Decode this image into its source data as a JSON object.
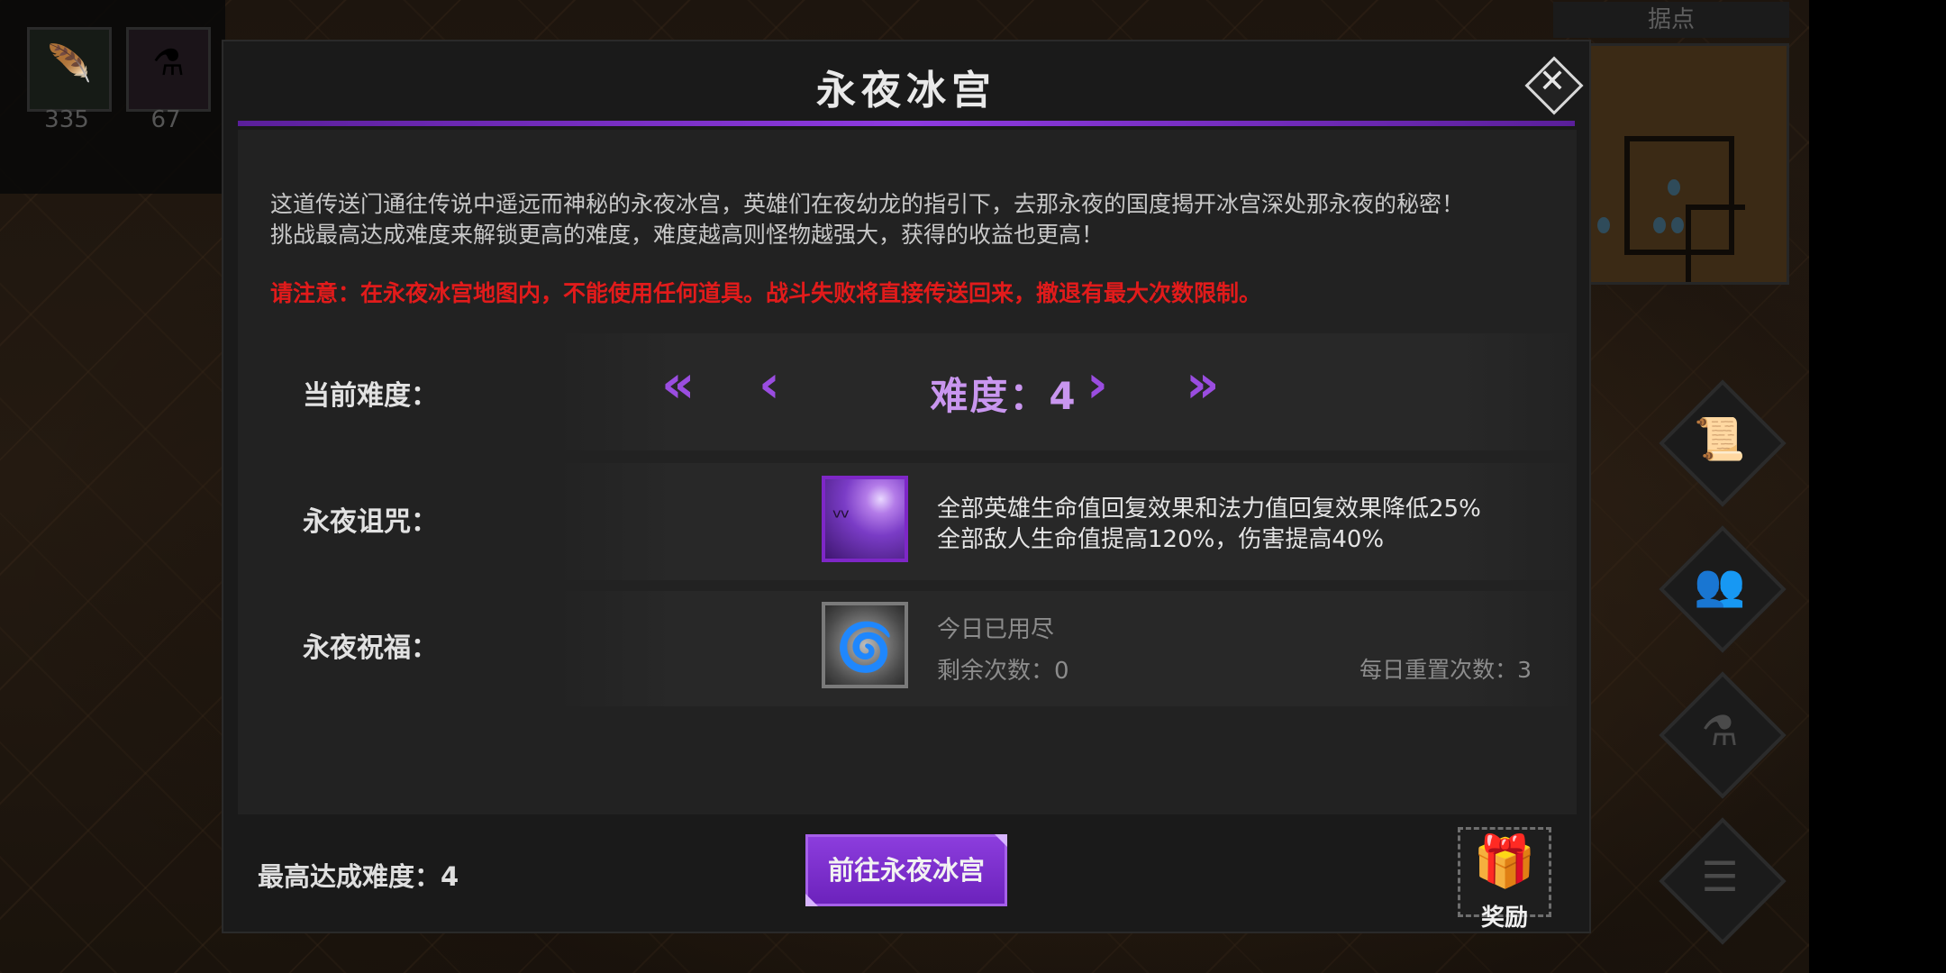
{
  "hud": {
    "resources": [
      {
        "icon": "feather-icon",
        "glyph": "🪶",
        "value": "335"
      },
      {
        "icon": "potion-icon",
        "glyph": "⚗",
        "value": "67"
      }
    ],
    "minimap_title": "据点",
    "side_menu": [
      {
        "name": "quest-scroll-icon",
        "glyph": "📜"
      },
      {
        "name": "heroes-icon",
        "glyph": "👥"
      },
      {
        "name": "potion-flask-icon",
        "glyph": "⚗"
      },
      {
        "name": "menu-list-icon",
        "glyph": "☰"
      }
    ]
  },
  "modal": {
    "title": "永夜冰宫",
    "close_glyph": "✕",
    "description": [
      "这道传送门通往传说中遥远而神秘的永夜冰宫，英雄们在夜幼龙的指引下，去那永夜的国度揭开冰宫深处那永夜的秘密！",
      "挑战最高达成难度来解锁更高的难度，难度越高则怪物越强大，获得的收益也更高！"
    ],
    "warning": "请注意：在永夜冰宫地图内，不能使用任何道具。战斗失败将直接传送回来，撤退有最大次数限制。",
    "difficulty": {
      "label": "当前难度：",
      "value_text": "难度：4",
      "first_glyph": "«",
      "prev_glyph": "‹",
      "next_glyph": "›",
      "last_glyph": "»"
    },
    "curse": {
      "label": "永夜诅咒：",
      "icon_glyph": "ᵛᵛ",
      "lines": [
        "全部英雄生命值回复效果和法力值回复效果降低25%",
        "全部敌人生命值提高120%，伤害提高40%"
      ]
    },
    "blessing": {
      "label": "永夜祝福：",
      "icon_glyph": "🌀",
      "status": "今日已用尽",
      "remaining": "剩余次数：0",
      "daily_reset": "每日重置次数：3"
    },
    "footer": {
      "max_difficulty": "最高达成难度：4",
      "go_button": "前往永夜冰宫",
      "reward_glyph": "🎁",
      "reward_label": "奖励"
    }
  },
  "colors": {
    "accent_purple": "#8c3ddd",
    "warning_red": "#e11b1b",
    "difficulty_text": "#c996ef"
  }
}
